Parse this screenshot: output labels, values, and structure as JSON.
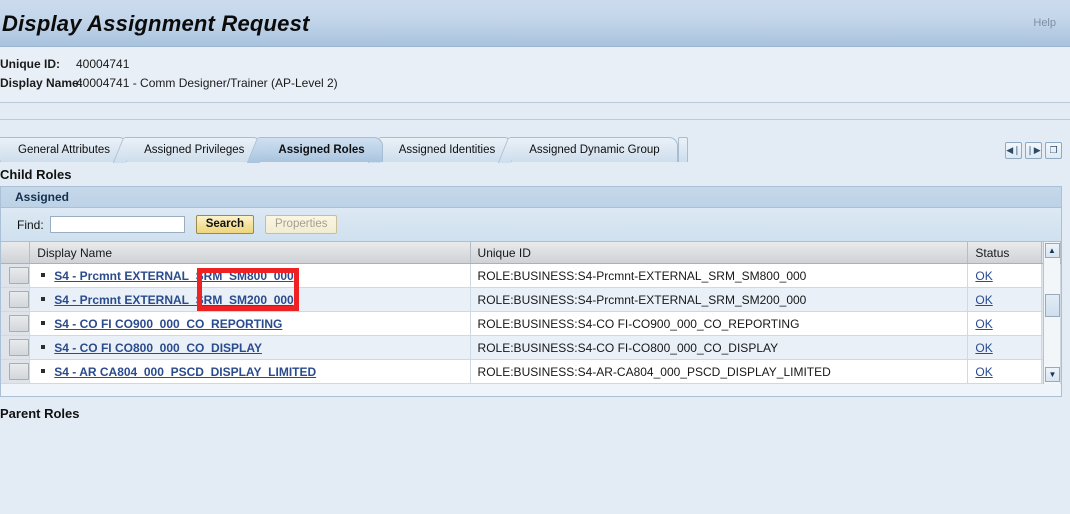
{
  "header": {
    "title": "Display Assignment Request",
    "help_label": "Help",
    "attributes": [
      {
        "label": "Unique ID:",
        "value": "40004741"
      },
      {
        "label": "Display Name:",
        "value": "40004741 - Comm Designer/Trainer (AP-Level 2)"
      }
    ]
  },
  "tabs": [
    {
      "label": "General Attributes",
      "active": false
    },
    {
      "label": "Assigned Privileges",
      "active": false
    },
    {
      "label": "Assigned Roles",
      "active": true
    },
    {
      "label": "Assigned Identities",
      "active": false
    },
    {
      "label": "Assigned Dynamic Group",
      "active": false
    }
  ],
  "tab_nav": [
    {
      "icon": "first-page-icon",
      "glyph": "◀❘"
    },
    {
      "icon": "last-page-icon",
      "glyph": "❘▶"
    },
    {
      "icon": "personalize-icon",
      "glyph": "❐"
    }
  ],
  "sections": {
    "child_roles_heading": "Child Roles",
    "parent_roles_heading": "Parent Roles"
  },
  "panel": {
    "header_label": "Assigned",
    "toolbar": {
      "find_label": "Find:",
      "find_value": "",
      "find_placeholder": "",
      "search_label": "Search",
      "properties_label": "Properties"
    }
  },
  "table": {
    "columns": [
      "Display Name",
      "Unique ID",
      "Status"
    ],
    "rows": [
      {
        "display_name": "S4 - Prcmnt EXTERNAL_SRM_SM800_000",
        "unique_id": "ROLE:BUSINESS:S4-Prcmnt-EXTERNAL_SRM_SM800_000",
        "status": "OK"
      },
      {
        "display_name": "S4 - Prcmnt EXTERNAL_SRM_SM200_000",
        "unique_id": "ROLE:BUSINESS:S4-Prcmnt-EXTERNAL_SRM_SM200_000",
        "status": "OK"
      },
      {
        "display_name": "S4 - CO FI CO900_000_CO_REPORTING",
        "unique_id": "ROLE:BUSINESS:S4-CO FI-CO900_000_CO_REPORTING",
        "status": "OK"
      },
      {
        "display_name": "S4 - CO FI CO800_000_CO_DISPLAY",
        "unique_id": "ROLE:BUSINESS:S4-CO FI-CO800_000_CO_DISPLAY",
        "status": "OK"
      },
      {
        "display_name": "S4 - AR CA804_000_PSCD_DISPLAY_LIMITED",
        "unique_id": "ROLE:BUSINESS:S4-AR-CA804_000_PSCD_DISPLAY_LIMITED",
        "status": "OK"
      }
    ],
    "scroll_up_glyph": "▲",
    "scroll_down_glyph": "▼"
  },
  "annotation": {
    "color": "#ee2222",
    "target": "search-button"
  }
}
